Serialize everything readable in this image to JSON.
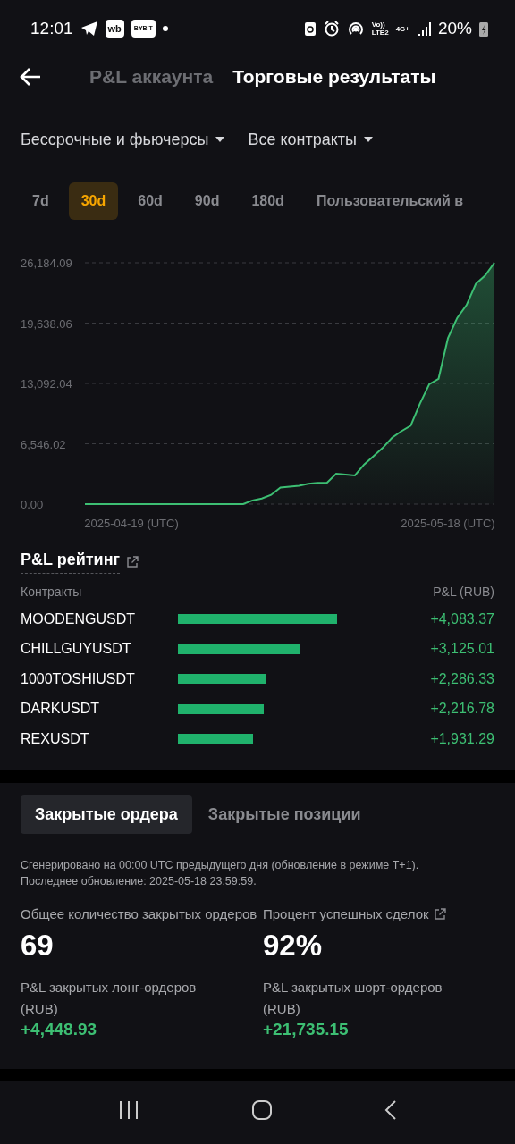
{
  "status_bar": {
    "time": "12:01",
    "app_badges": [
      "wb",
      "BYBIT"
    ],
    "network_top": "Vo))",
    "network_bottom": "LTE2",
    "data_type": "4G+",
    "battery": "20%"
  },
  "header": {
    "tabs": [
      {
        "label": "P&L аккаунта",
        "selected": false
      },
      {
        "label": "Торговые результаты",
        "selected": true
      }
    ]
  },
  "filters": [
    {
      "label": "Бессрочные и фьючерсы"
    },
    {
      "label": "Все контракты"
    }
  ],
  "ranges": [
    {
      "label": "7d",
      "selected": false
    },
    {
      "label": "30d",
      "selected": true
    },
    {
      "label": "60d",
      "selected": false
    },
    {
      "label": "90d",
      "selected": false
    },
    {
      "label": "180d",
      "selected": false
    },
    {
      "label": "Пользовательский в",
      "selected": false
    }
  ],
  "chart": {
    "chart_data": {
      "type": "area",
      "grid": true,
      "categories": [
        null,
        null,
        null,
        null,
        null,
        "2025-04-19 (UTC)",
        null,
        null,
        null,
        null,
        null,
        null,
        null,
        null,
        null,
        null,
        null,
        null,
        null,
        null,
        null,
        null,
        null,
        null,
        null,
        null,
        null,
        null,
        null,
        null,
        null,
        null,
        null,
        null,
        null,
        null,
        null,
        null,
        null,
        "2025-05-18 (UTC)",
        null,
        null,
        null,
        null,
        null
      ],
      "series": [
        {
          "color": "#3dbf73",
          "values": [
            0,
            0,
            0,
            0,
            0,
            0,
            0,
            0,
            0,
            0,
            0,
            0,
            0,
            0,
            0,
            0,
            0,
            0,
            400,
            600,
            1000,
            1800,
            1900,
            2000,
            2200,
            2300,
            2300,
            3300,
            3200,
            3100,
            4300,
            5200,
            6100,
            7200,
            7900,
            8500,
            10900,
            13000,
            13600,
            18000,
            20200,
            21600,
            23900,
            24800,
            26180
          ]
        }
      ],
      "yticks": [
        {
          "value": 0,
          "label": "0.00"
        },
        {
          "value": 6546.02,
          "label": "6,546.02"
        },
        {
          "value": 13092.04,
          "label": "13,092.04"
        },
        {
          "value": 19638.06,
          "label": "19,638.06"
        },
        {
          "value": 26184.09,
          "label": "26,184.09"
        }
      ],
      "ylim": [
        0,
        26184.09
      ]
    }
  },
  "ranking": {
    "title": "P&L рейтинг",
    "columns": [
      "Контракты",
      "P&L (RUB)"
    ],
    "rows": [
      {
        "contract": "MOODENGUSDT",
        "pnl": "+4,083.37"
      },
      {
        "contract": "CHILLGUYUSDT",
        "pnl": "+3,125.01"
      },
      {
        "contract": "1000TOSHIUSDT",
        "pnl": "+2,286.33"
      },
      {
        "contract": "DARKUSDT",
        "pnl": "+2,216.78"
      },
      {
        "contract": "REXUSDT",
        "pnl": "+1,931.29"
      }
    ]
  },
  "orders": {
    "tabs": [
      {
        "label": "Закрытые ордера",
        "selected": true
      },
      {
        "label": "Закрытые позиции",
        "selected": false
      }
    ],
    "note_lines": [
      "Сгенерировано на 00:00 UTC предыдущего дня (обновление в режиме T+1).",
      "Последнее обновление: 2025-05-18 23:59:59."
    ],
    "stats": [
      {
        "kind": "count",
        "label": "Общее количество закрытых ордеров",
        "value": "69",
        "link": false
      },
      {
        "kind": "count",
        "label": "Процент успешных сделок",
        "value": "92%",
        "link": true
      },
      {
        "kind": "pnl",
        "label": "P&L закрытых лонг-ордеров (RUB)",
        "value": "+4,448.93",
        "link": false
      },
      {
        "kind": "pnl",
        "label": "P&L закрытых шорт-ордеров (RUB)",
        "value": "+21,735.15",
        "link": false
      }
    ]
  }
}
